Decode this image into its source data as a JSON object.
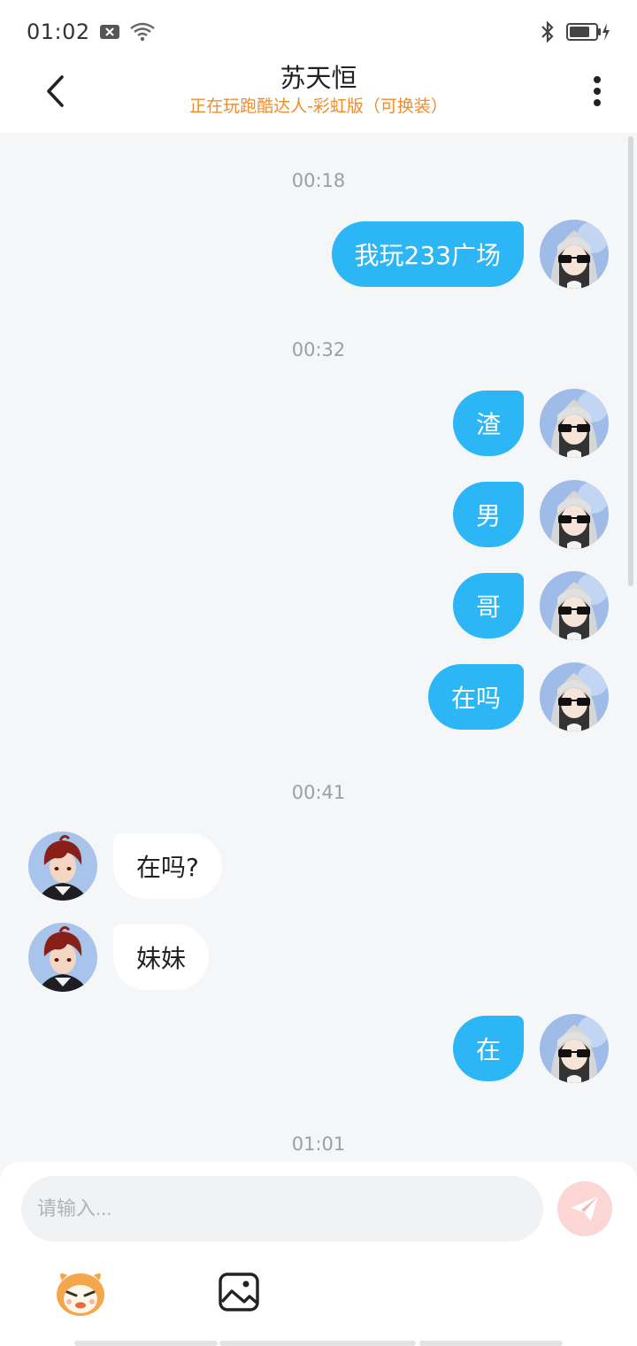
{
  "status_bar": {
    "time": "01:02",
    "icons": [
      "notification-x-icon",
      "wifi-icon",
      "bluetooth-icon",
      "battery-charging-icon"
    ]
  },
  "header": {
    "title": "苏天恒",
    "subtitle": "正在玩跑酷达人-彩虹版（可换装）"
  },
  "messages": [
    {
      "type": "time",
      "text": "00:18"
    },
    {
      "type": "msg",
      "from": "me",
      "text": "我玩233广场"
    },
    {
      "type": "time",
      "text": "00:32"
    },
    {
      "type": "msg",
      "from": "me",
      "text": "渣"
    },
    {
      "type": "msg",
      "from": "me",
      "text": "男"
    },
    {
      "type": "msg",
      "from": "me",
      "text": "哥"
    },
    {
      "type": "msg",
      "from": "me",
      "text": "在吗"
    },
    {
      "type": "time",
      "text": "00:41"
    },
    {
      "type": "msg",
      "from": "them",
      "text": "在吗?"
    },
    {
      "type": "msg",
      "from": "them",
      "text": "妹妹"
    },
    {
      "type": "msg",
      "from": "me",
      "text": "在"
    },
    {
      "type": "time",
      "text": "01:01"
    }
  ],
  "input": {
    "placeholder": "请输入...",
    "value": ""
  },
  "toolbar": {
    "icons": [
      "emoji-mascot-icon",
      "image-icon"
    ]
  },
  "colors": {
    "my_bubble": "#2db6f6",
    "their_bubble": "#ffffff",
    "subtitle": "#f08c2c",
    "background": "#f4f6f7",
    "send_button": "#fbd6d4"
  }
}
